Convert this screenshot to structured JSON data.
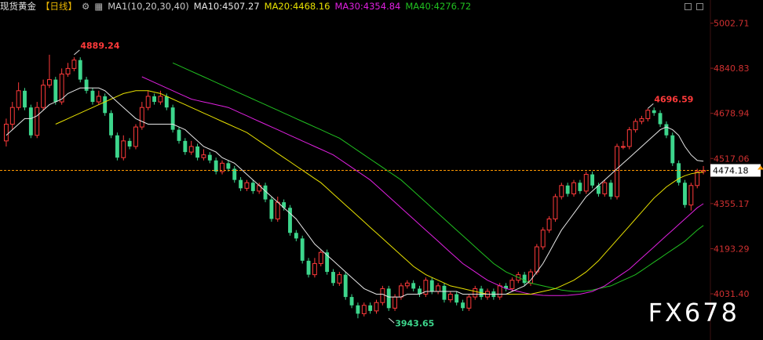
{
  "header": {
    "title": "现货黄金",
    "period": "【日线】",
    "icon_settings": "gear-icon",
    "icon_indicator": "chart-line-icon",
    "ma_params": "MA1(10,20,30,40)",
    "ma10_text": "MA10:4507.27",
    "ma20_text": "MA20:4468.16",
    "ma30_text": "MA30:4354.84",
    "ma40_text": "MA40:4276.72"
  },
  "watermark": "FX678",
  "colors": {
    "up": "#ff3a3a",
    "down": "#3dd68c",
    "ma10": "#e6e6e6",
    "ma20": "#e8e100",
    "ma30": "#e020e0",
    "ma40": "#20c020",
    "current_price_line": "#ff9800",
    "price_tag_bg": "#ffffff"
  },
  "chart_data": {
    "type": "candlestick",
    "title": "现货黄金【日线】",
    "y_axis_ticks": [
      "5002.71",
      "4840.83",
      "4678.94",
      "4517.06",
      "4355.17",
      "4193.29",
      "4031.40"
    ],
    "ylim": [
      3905,
      5035
    ],
    "current_price": "4474.18",
    "annotations": [
      {
        "label": "4889.24",
        "x": 11,
        "y": 4889.24,
        "kind": "high"
      },
      {
        "label": "4696.59",
        "x": 104,
        "y": 4696.59,
        "kind": "high"
      },
      {
        "label": "3943.65",
        "x": 62,
        "y": 3943.65,
        "kind": "low"
      }
    ],
    "close": [
      4640,
      4700,
      4760,
      4700,
      4600,
      4700,
      4780,
      4800,
      4720,
      4820,
      4840,
      4870,
      4800,
      4760,
      4720,
      4740,
      4680,
      4600,
      4520,
      4580,
      4560,
      4630,
      4700,
      4740,
      4720,
      4740,
      4700,
      4620,
      4580,
      4540,
      4560,
      4520,
      4530,
      4510,
      4470,
      4500,
      4480,
      4440,
      4410,
      4430,
      4400,
      4420,
      4370,
      4300,
      4360,
      4340,
      4250,
      4230,
      4150,
      4100,
      4140,
      4180,
      4110,
      4070,
      4100,
      4020,
      3990,
      3960,
      3990,
      3970,
      4000,
      4050,
      3980,
      4020,
      4060,
      4070,
      4050,
      4030,
      4080,
      4040,
      4060,
      4010,
      4030,
      4000,
      3980,
      4020,
      4050,
      4020,
      4040,
      4020,
      4060,
      4050,
      4080,
      4100,
      4070,
      4110,
      4200,
      4260,
      4300,
      4380,
      4420,
      4390,
      4430,
      4400,
      4460,
      4420,
      4390,
      4430,
      4380,
      4560,
      4560,
      4620,
      4650,
      4660,
      4690,
      4680,
      4640,
      4600,
      4500,
      4430,
      4350,
      4420,
      4470,
      4474.18
    ],
    "open": [
      4580,
      4640,
      4700,
      4760,
      4700,
      4600,
      4700,
      4780,
      4800,
      4720,
      4820,
      4840,
      4870,
      4800,
      4760,
      4720,
      4740,
      4680,
      4600,
      4520,
      4580,
      4560,
      4630,
      4700,
      4740,
      4720,
      4740,
      4700,
      4620,
      4580,
      4540,
      4560,
      4520,
      4530,
      4510,
      4470,
      4500,
      4480,
      4440,
      4410,
      4430,
      4400,
      4420,
      4370,
      4300,
      4360,
      4340,
      4250,
      4230,
      4150,
      4100,
      4140,
      4180,
      4110,
      4070,
      4100,
      4020,
      3990,
      3960,
      3990,
      3970,
      4000,
      4050,
      3980,
      4020,
      4060,
      4070,
      4050,
      4030,
      4080,
      4040,
      4060,
      4010,
      4030,
      4000,
      3980,
      4020,
      4050,
      4020,
      4040,
      4020,
      4060,
      4050,
      4080,
      4100,
      4070,
      4110,
      4200,
      4260,
      4300,
      4380,
      4420,
      4390,
      4430,
      4400,
      4460,
      4420,
      4390,
      4430,
      4380,
      4560,
      4560,
      4620,
      4650,
      4660,
      4690,
      4680,
      4640,
      4600,
      4500,
      4430,
      4350,
      4420,
      4470
    ],
    "high": [
      4660,
      4720,
      4790,
      4770,
      4710,
      4720,
      4800,
      4889.24,
      4810,
      4840,
      4860,
      4880,
      4880,
      4810,
      4770,
      4760,
      4750,
      4690,
      4610,
      4600,
      4590,
      4640,
      4720,
      4760,
      4750,
      4760,
      4750,
      4710,
      4630,
      4590,
      4580,
      4570,
      4550,
      4540,
      4520,
      4510,
      4510,
      4490,
      4450,
      4440,
      4440,
      4430,
      4430,
      4380,
      4380,
      4370,
      4350,
      4260,
      4240,
      4160,
      4160,
      4190,
      4190,
      4120,
      4110,
      4110,
      4030,
      4000,
      4000,
      4000,
      4010,
      4060,
      4060,
      4030,
      4070,
      4080,
      4080,
      4060,
      4090,
      4090,
      4070,
      4070,
      4040,
      4040,
      4010,
      4030,
      4060,
      4060,
      4050,
      4050,
      4070,
      4070,
      4090,
      4110,
      4110,
      4120,
      4210,
      4270,
      4310,
      4390,
      4430,
      4430,
      4440,
      4440,
      4470,
      4470,
      4430,
      4440,
      4440,
      4570,
      4580,
      4630,
      4660,
      4670,
      4696.59,
      4700,
      4690,
      4650,
      4610,
      4510,
      4440,
      4430,
      4480,
      4490
    ],
    "low": [
      4560,
      4620,
      4690,
      4690,
      4590,
      4590,
      4690,
      4770,
      4710,
      4710,
      4810,
      4830,
      4790,
      4750,
      4710,
      4710,
      4670,
      4590,
      4510,
      4510,
      4550,
      4550,
      4620,
      4690,
      4710,
      4710,
      4690,
      4610,
      4570,
      4530,
      4530,
      4510,
      4510,
      4500,
      4460,
      4460,
      4470,
      4430,
      4400,
      4400,
      4390,
      4390,
      4360,
      4290,
      4290,
      4330,
      4240,
      4220,
      4140,
      4090,
      4090,
      4130,
      4100,
      4060,
      4060,
      4010,
      3980,
      3943.65,
      3950,
      3960,
      3960,
      3990,
      3970,
      3970,
      4010,
      4050,
      4040,
      4020,
      4020,
      4030,
      4030,
      4000,
      4000,
      3990,
      3970,
      3970,
      4010,
      4010,
      4010,
      4010,
      4010,
      4040,
      4040,
      4070,
      4060,
      4060,
      4100,
      4190,
      4250,
      4290,
      4370,
      4380,
      4380,
      4390,
      4390,
      4410,
      4380,
      4380,
      4370,
      4370,
      4550,
      4550,
      4610,
      4640,
      4650,
      4670,
      4630,
      4590,
      4490,
      4420,
      4340,
      4330,
      4410,
      4460
    ],
    "ma10": [
      4600,
      4620,
      4640,
      4660,
      4660,
      4670,
      4690,
      4710,
      4720,
      4730,
      4750,
      4760,
      4770,
      4770,
      4770,
      4770,
      4760,
      4740,
      4720,
      4700,
      4680,
      4660,
      4650,
      4640,
      4640,
      4640,
      4640,
      4640,
      4630,
      4620,
      4600,
      4580,
      4560,
      4550,
      4540,
      4520,
      4510,
      4500,
      4480,
      4460,
      4440,
      4420,
      4400,
      4380,
      4360,
      4340,
      4320,
      4300,
      4270,
      4240,
      4210,
      4190,
      4170,
      4150,
      4130,
      4110,
      4090,
      4070,
      4050,
      4040,
      4030,
      4030,
      4020,
      4020,
      4020,
      4030,
      4030,
      4030,
      4040,
      4040,
      4040,
      4040,
      4040,
      4040,
      4030,
      4030,
      4030,
      4030,
      4030,
      4030,
      4030,
      4030,
      4040,
      4050,
      4060,
      4080,
      4110,
      4140,
      4180,
      4220,
      4260,
      4290,
      4320,
      4350,
      4380,
      4400,
      4420,
      4440,
      4460,
      4480,
      4500,
      4520,
      4540,
      4560,
      4580,
      4600,
      4620,
      4630,
      4620,
      4600,
      4560,
      4530,
      4510,
      4507.27
    ],
    "ma20": [
      4640,
      4650,
      4660,
      4670,
      4680,
      4690,
      4700,
      4710,
      4720,
      4730,
      4740,
      4750,
      4755,
      4760,
      4760,
      4760,
      4755,
      4750,
      4740,
      4730,
      4720,
      4710,
      4700,
      4690,
      4680,
      4670,
      4660,
      4650,
      4640,
      4630,
      4620,
      4610,
      4595,
      4580,
      4565,
      4550,
      4535,
      4520,
      4505,
      4490,
      4475,
      4460,
      4445,
      4430,
      4410,
      4390,
      4370,
      4350,
      4330,
      4310,
      4290,
      4270,
      4250,
      4230,
      4210,
      4190,
      4170,
      4150,
      4130,
      4115,
      4100,
      4090,
      4080,
      4070,
      4060,
      4055,
      4050,
      4045,
      4040,
      4035,
      4030,
      4030,
      4030,
      4030,
      4030,
      4030,
      4030,
      4030,
      4035,
      4040,
      4045,
      4050,
      4060,
      4070,
      4080,
      4095,
      4110,
      4130,
      4150,
      4175,
      4200,
      4225,
      4250,
      4275,
      4300,
      4325,
      4350,
      4375,
      4395,
      4415,
      4430,
      4445,
      4455,
      4462,
      4466,
      4468.16
    ],
    "ma30": [
      4810,
      4800,
      4790,
      4780,
      4770,
      4760,
      4750,
      4740,
      4730,
      4725,
      4720,
      4715,
      4710,
      4705,
      4700,
      4690,
      4680,
      4670,
      4660,
      4650,
      4640,
      4630,
      4620,
      4610,
      4600,
      4590,
      4580,
      4570,
      4560,
      4550,
      4540,
      4530,
      4515,
      4500,
      4485,
      4470,
      4455,
      4440,
      4420,
      4400,
      4380,
      4360,
      4340,
      4320,
      4300,
      4280,
      4260,
      4240,
      4220,
      4200,
      4180,
      4160,
      4140,
      4125,
      4110,
      4095,
      4080,
      4070,
      4060,
      4050,
      4045,
      4040,
      4035,
      4030,
      4028,
      4026,
      4025,
      4025,
      4025,
      4026,
      4028,
      4030,
      4035,
      4040,
      4050,
      4060,
      4075,
      4090,
      4105,
      4120,
      4140,
      4160,
      4180,
      4200,
      4220,
      4240,
      4260,
      4280,
      4300,
      4320,
      4340,
      4354.84
    ],
    "ma40": [
      4860,
      4850,
      4840,
      4830,
      4820,
      4810,
      4800,
      4790,
      4780,
      4770,
      4760,
      4750,
      4740,
      4730,
      4720,
      4710,
      4700,
      4690,
      4680,
      4670,
      4660,
      4650,
      4640,
      4630,
      4620,
      4610,
      4600,
      4590,
      4575,
      4560,
      4545,
      4530,
      4515,
      4500,
      4485,
      4470,
      4455,
      4440,
      4420,
      4400,
      4380,
      4360,
      4340,
      4320,
      4300,
      4280,
      4260,
      4240,
      4220,
      4200,
      4180,
      4160,
      4140,
      4125,
      4110,
      4100,
      4090,
      4080,
      4070,
      4065,
      4060,
      4055,
      4050,
      4045,
      4042,
      4040,
      4040,
      4042,
      4045,
      4050,
      4055,
      4060,
      4070,
      4080,
      4090,
      4100,
      4115,
      4130,
      4145,
      4160,
      4175,
      4190,
      4205,
      4220,
      4240,
      4260,
      4276.72
    ]
  }
}
